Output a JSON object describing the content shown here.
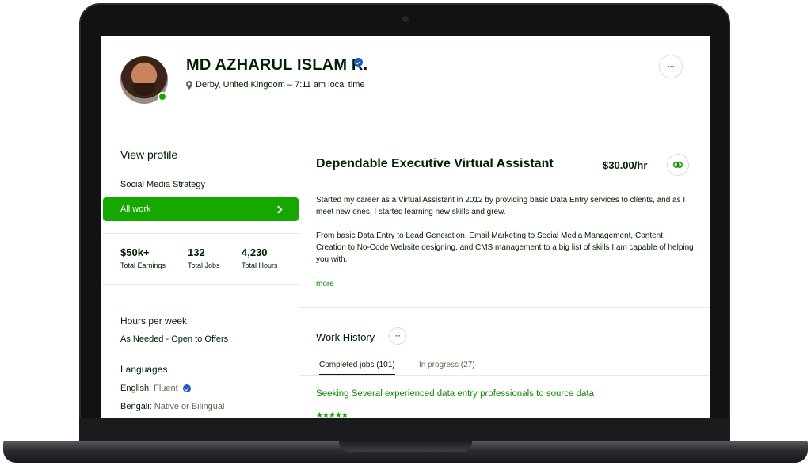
{
  "profile": {
    "name": "MD AZHARUL ISLAM R.",
    "location": "Derby, United Kingdom – 7:11 am local time",
    "more_label": "···"
  },
  "sidebar": {
    "view_profile": "View profile",
    "specialty": "Social Media Strategy",
    "all_work": "All work",
    "stats": [
      {
        "value": "$50k+",
        "label": "Total Earnings"
      },
      {
        "value": "132",
        "label": "Total Jobs"
      },
      {
        "value": "4,230",
        "label": "Total Hours"
      }
    ],
    "hours_title": "Hours per week",
    "hours_value": "As Needed - Open to Offers",
    "languages_title": "Languages",
    "languages": [
      {
        "name": "English:",
        "level": "Fluent"
      },
      {
        "name": "Bengali:",
        "level": "Native or Bilingual"
      }
    ]
  },
  "main": {
    "title": "Dependable Executive Virtual Assistant",
    "rate": "$30.00/hr",
    "desc1": "Started my career as a Virtual Assistant in 2012 by providing basic Data Entry services to clients, and as I meet new ones, I started learning new skills and grew.",
    "desc2": "From basic Data Entry to Lead Generation, Email Marketing to Social Media Management, Content Creation to No-Code Website designing, and CMS management to a big list of skills I am capable of helping you with.",
    "ellipsis": "..",
    "more": "more"
  },
  "work_history": {
    "title": "Work History",
    "tabs": [
      "Completed jobs (101)",
      "In progress (27)"
    ],
    "first_job": "Seeking Several experienced data entry professionals to source data",
    "first_rating": "★★★★★"
  },
  "colors": {
    "brand_green": "#14a800",
    "link_green": "#108a00",
    "verified_blue": "#1f57c3",
    "text": "#001e00"
  }
}
